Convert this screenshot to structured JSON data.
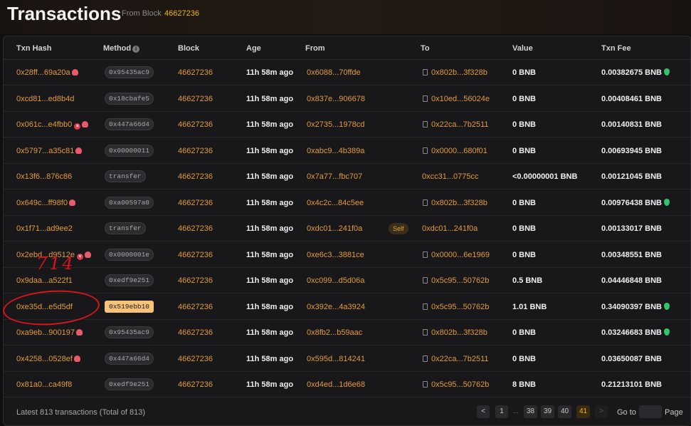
{
  "header": {
    "title": "Transactions",
    "from_label": "From Block",
    "from_block": "46627236"
  },
  "columns": {
    "txn_hash": "Txn Hash",
    "method": "Method",
    "block": "Block",
    "age": "Age",
    "from": "From",
    "to": "To",
    "value": "Value",
    "txn_fee": "Txn Fee"
  },
  "rows": [
    {
      "hash": "0x28ff...69a20a",
      "method": "0x95435ac9",
      "block": "46627236",
      "age": "11h 58m ago",
      "from": "0x6088...70ffde",
      "to": "0x802b...3f328b",
      "value": "0 BNB",
      "fee": "0.00382675 BNB"
    },
    {
      "hash": "0xcd81...ed8b4d",
      "method": "0x18cbafe5",
      "block": "46627236",
      "age": "11h 58m ago",
      "from": "0x837e...906678",
      "to": "0x10ed...56024e",
      "value": "0 BNB",
      "fee": "0.00408461 BNB"
    },
    {
      "hash": "0x061c...e4fbb0",
      "method": "0x447a66d4",
      "block": "46627236",
      "age": "11h 58m ago",
      "from": "0x2735...1978cd",
      "to": "0x22ca...7b2511",
      "value": "0 BNB",
      "fee": "0.00140831 BNB"
    },
    {
      "hash": "0x5797...a35c81",
      "method": "0x00000011",
      "block": "46627236",
      "age": "11h 58m ago",
      "from": "0xabc9...4b389a",
      "to": "0x0000...680f01",
      "value": "0 BNB",
      "fee": "0.00693945 BNB"
    },
    {
      "hash": "0x13f6...876c86",
      "method": "transfer",
      "block": "46627236",
      "age": "11h 58m ago",
      "from": "0x7a77...fbc707",
      "to": "0xcc31...0775cc",
      "value": "<0.00000001 BNB",
      "fee": "0.00121045 BNB"
    },
    {
      "hash": "0x649c...ff98f0",
      "method": "0xa00597a0",
      "block": "46627236",
      "age": "11h 58m ago",
      "from": "0x4c2c...84c5ee",
      "to": "0x802b...3f328b",
      "value": "0 BNB",
      "fee": "0.00976438 BNB"
    },
    {
      "hash": "0x1f71...ad9ee2",
      "method": "transfer",
      "block": "46627236",
      "age": "11h 58m ago",
      "from": "0xdc01...241f0a",
      "self": "Self",
      "to": "0xdc01...241f0a",
      "value": "0 BNB",
      "fee": "0.00133017 BNB"
    },
    {
      "hash": "0x2ebd...d9512e",
      "method": "0x0000001e",
      "block": "46627236",
      "age": "11h 58m ago",
      "from": "0xe6c3...3881ce",
      "to": "0x0000...6e1969",
      "value": "0 BNB",
      "fee": "0.00348551 BNB"
    },
    {
      "hash": "0x9daa...a522f1",
      "method": "0xedf9e251",
      "block": "46627236",
      "age": "11h 58m ago",
      "from": "0xc099...d5d06a",
      "to": "0x5c95...50762b",
      "value": "0.5 BNB",
      "fee": "0.04446848 BNB"
    },
    {
      "hash": "0xe35d...e5d5df",
      "method": "0x519ebb10",
      "block": "46627236",
      "age": "11h 58m ago",
      "from": "0x392e...4a3924",
      "to": "0x5c95...50762b",
      "value": "1.01 BNB",
      "fee": "0.34090397 BNB"
    },
    {
      "hash": "0xa9eb...900197",
      "method": "0x95435ac9",
      "block": "46627236",
      "age": "11h 58m ago",
      "from": "0x8fb2...b59aac",
      "to": "0x802b...3f328b",
      "value": "0 BNB",
      "fee": "0.03246683 BNB"
    },
    {
      "hash": "0x4258...0528ef",
      "method": "0x447a66d4",
      "block": "46627236",
      "age": "11h 58m ago",
      "from": "0x595d...814241",
      "to": "0x22ca...7b2511",
      "value": "0 BNB",
      "fee": "0.03650087 BNB"
    },
    {
      "hash": "0x81a0...ca49f8",
      "method": "0xedf9e251",
      "block": "46627236",
      "age": "11h 58m ago",
      "from": "0xd4ed...1d6e68",
      "to": "0x5c95...50762b",
      "value": "8 BNB",
      "fee": "0.21213101 BNB"
    }
  ],
  "footer": {
    "summary": "Latest 813 transactions (Total of 813)",
    "pages": [
      "1",
      "...",
      "38",
      "39",
      "40",
      "41"
    ],
    "prev": "<",
    "next": ">",
    "goto_label": "Go to",
    "page_label": "Page"
  },
  "annotation": {
    "text": "714"
  }
}
